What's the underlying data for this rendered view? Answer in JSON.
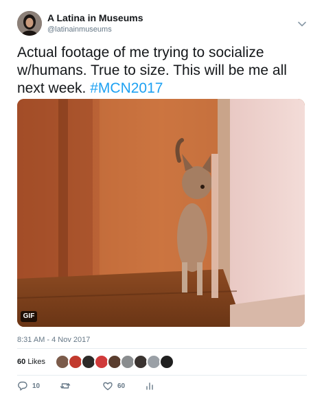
{
  "account": {
    "display_name": "A Latina in Museums",
    "handle": "@latinainmuseums"
  },
  "tweet": {
    "text": "Actual footage of me trying to socialize w/humans. True to size. This will be me all next week.",
    "hashtag": "#MCN2017",
    "media_badge": "GIF",
    "timestamp": "8:31 AM - 4 Nov 2017"
  },
  "engagement": {
    "likes_count": "60",
    "likes_label": "Likes",
    "liker_avatar_count": 9
  },
  "actions": {
    "reply_count": "10",
    "retweet_count": "",
    "like_count": "60"
  },
  "colors": {
    "accent": "#1da1f2",
    "secondary_text": "#657786",
    "divider": "#e6ecf0"
  }
}
